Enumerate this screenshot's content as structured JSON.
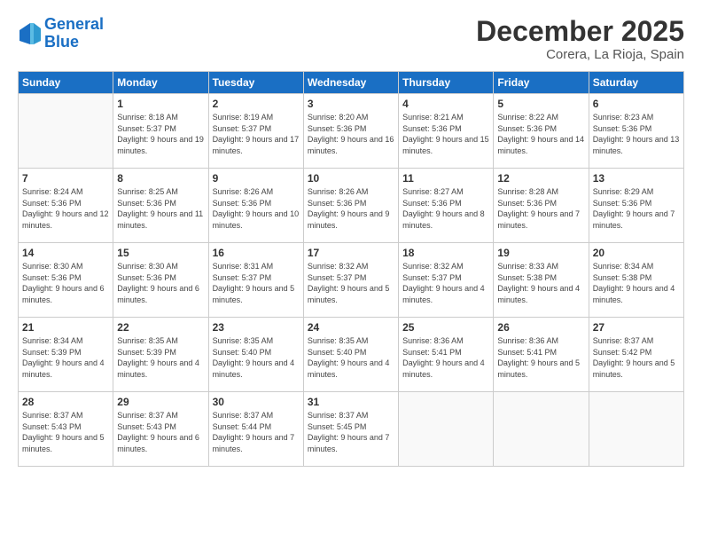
{
  "header": {
    "logo_line1": "General",
    "logo_line2": "Blue",
    "month_title": "December 2025",
    "location": "Corera, La Rioja, Spain"
  },
  "days_of_week": [
    "Sunday",
    "Monday",
    "Tuesday",
    "Wednesday",
    "Thursday",
    "Friday",
    "Saturday"
  ],
  "weeks": [
    [
      {
        "day": "",
        "sunrise": "",
        "sunset": "",
        "daylight": ""
      },
      {
        "day": "1",
        "sunrise": "Sunrise: 8:18 AM",
        "sunset": "Sunset: 5:37 PM",
        "daylight": "Daylight: 9 hours and 19 minutes."
      },
      {
        "day": "2",
        "sunrise": "Sunrise: 8:19 AM",
        "sunset": "Sunset: 5:37 PM",
        "daylight": "Daylight: 9 hours and 17 minutes."
      },
      {
        "day": "3",
        "sunrise": "Sunrise: 8:20 AM",
        "sunset": "Sunset: 5:36 PM",
        "daylight": "Daylight: 9 hours and 16 minutes."
      },
      {
        "day": "4",
        "sunrise": "Sunrise: 8:21 AM",
        "sunset": "Sunset: 5:36 PM",
        "daylight": "Daylight: 9 hours and 15 minutes."
      },
      {
        "day": "5",
        "sunrise": "Sunrise: 8:22 AM",
        "sunset": "Sunset: 5:36 PM",
        "daylight": "Daylight: 9 hours and 14 minutes."
      },
      {
        "day": "6",
        "sunrise": "Sunrise: 8:23 AM",
        "sunset": "Sunset: 5:36 PM",
        "daylight": "Daylight: 9 hours and 13 minutes."
      }
    ],
    [
      {
        "day": "7",
        "sunrise": "Sunrise: 8:24 AM",
        "sunset": "Sunset: 5:36 PM",
        "daylight": "Daylight: 9 hours and 12 minutes."
      },
      {
        "day": "8",
        "sunrise": "Sunrise: 8:25 AM",
        "sunset": "Sunset: 5:36 PM",
        "daylight": "Daylight: 9 hours and 11 minutes."
      },
      {
        "day": "9",
        "sunrise": "Sunrise: 8:26 AM",
        "sunset": "Sunset: 5:36 PM",
        "daylight": "Daylight: 9 hours and 10 minutes."
      },
      {
        "day": "10",
        "sunrise": "Sunrise: 8:26 AM",
        "sunset": "Sunset: 5:36 PM",
        "daylight": "Daylight: 9 hours and 9 minutes."
      },
      {
        "day": "11",
        "sunrise": "Sunrise: 8:27 AM",
        "sunset": "Sunset: 5:36 PM",
        "daylight": "Daylight: 9 hours and 8 minutes."
      },
      {
        "day": "12",
        "sunrise": "Sunrise: 8:28 AM",
        "sunset": "Sunset: 5:36 PM",
        "daylight": "Daylight: 9 hours and 7 minutes."
      },
      {
        "day": "13",
        "sunrise": "Sunrise: 8:29 AM",
        "sunset": "Sunset: 5:36 PM",
        "daylight": "Daylight: 9 hours and 7 minutes."
      }
    ],
    [
      {
        "day": "14",
        "sunrise": "Sunrise: 8:30 AM",
        "sunset": "Sunset: 5:36 PM",
        "daylight": "Daylight: 9 hours and 6 minutes."
      },
      {
        "day": "15",
        "sunrise": "Sunrise: 8:30 AM",
        "sunset": "Sunset: 5:36 PM",
        "daylight": "Daylight: 9 hours and 6 minutes."
      },
      {
        "day": "16",
        "sunrise": "Sunrise: 8:31 AM",
        "sunset": "Sunset: 5:37 PM",
        "daylight": "Daylight: 9 hours and 5 minutes."
      },
      {
        "day": "17",
        "sunrise": "Sunrise: 8:32 AM",
        "sunset": "Sunset: 5:37 PM",
        "daylight": "Daylight: 9 hours and 5 minutes."
      },
      {
        "day": "18",
        "sunrise": "Sunrise: 8:32 AM",
        "sunset": "Sunset: 5:37 PM",
        "daylight": "Daylight: 9 hours and 4 minutes."
      },
      {
        "day": "19",
        "sunrise": "Sunrise: 8:33 AM",
        "sunset": "Sunset: 5:38 PM",
        "daylight": "Daylight: 9 hours and 4 minutes."
      },
      {
        "day": "20",
        "sunrise": "Sunrise: 8:34 AM",
        "sunset": "Sunset: 5:38 PM",
        "daylight": "Daylight: 9 hours and 4 minutes."
      }
    ],
    [
      {
        "day": "21",
        "sunrise": "Sunrise: 8:34 AM",
        "sunset": "Sunset: 5:39 PM",
        "daylight": "Daylight: 9 hours and 4 minutes."
      },
      {
        "day": "22",
        "sunrise": "Sunrise: 8:35 AM",
        "sunset": "Sunset: 5:39 PM",
        "daylight": "Daylight: 9 hours and 4 minutes."
      },
      {
        "day": "23",
        "sunrise": "Sunrise: 8:35 AM",
        "sunset": "Sunset: 5:40 PM",
        "daylight": "Daylight: 9 hours and 4 minutes."
      },
      {
        "day": "24",
        "sunrise": "Sunrise: 8:35 AM",
        "sunset": "Sunset: 5:40 PM",
        "daylight": "Daylight: 9 hours and 4 minutes."
      },
      {
        "day": "25",
        "sunrise": "Sunrise: 8:36 AM",
        "sunset": "Sunset: 5:41 PM",
        "daylight": "Daylight: 9 hours and 4 minutes."
      },
      {
        "day": "26",
        "sunrise": "Sunrise: 8:36 AM",
        "sunset": "Sunset: 5:41 PM",
        "daylight": "Daylight: 9 hours and 5 minutes."
      },
      {
        "day": "27",
        "sunrise": "Sunrise: 8:37 AM",
        "sunset": "Sunset: 5:42 PM",
        "daylight": "Daylight: 9 hours and 5 minutes."
      }
    ],
    [
      {
        "day": "28",
        "sunrise": "Sunrise: 8:37 AM",
        "sunset": "Sunset: 5:43 PM",
        "daylight": "Daylight: 9 hours and 5 minutes."
      },
      {
        "day": "29",
        "sunrise": "Sunrise: 8:37 AM",
        "sunset": "Sunset: 5:43 PM",
        "daylight": "Daylight: 9 hours and 6 minutes."
      },
      {
        "day": "30",
        "sunrise": "Sunrise: 8:37 AM",
        "sunset": "Sunset: 5:44 PM",
        "daylight": "Daylight: 9 hours and 7 minutes."
      },
      {
        "day": "31",
        "sunrise": "Sunrise: 8:37 AM",
        "sunset": "Sunset: 5:45 PM",
        "daylight": "Daylight: 9 hours and 7 minutes."
      },
      {
        "day": "",
        "sunrise": "",
        "sunset": "",
        "daylight": ""
      },
      {
        "day": "",
        "sunrise": "",
        "sunset": "",
        "daylight": ""
      },
      {
        "day": "",
        "sunrise": "",
        "sunset": "",
        "daylight": ""
      }
    ]
  ]
}
